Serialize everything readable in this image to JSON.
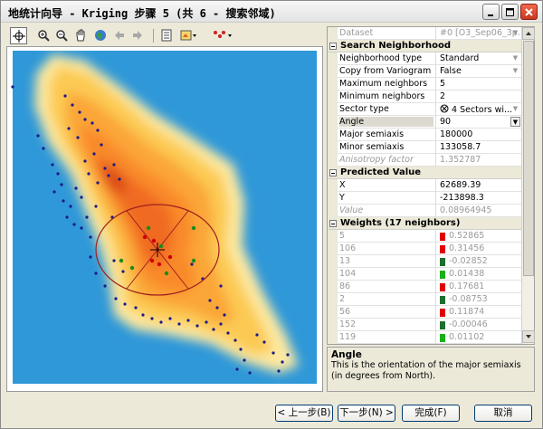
{
  "window": {
    "title": "地统计向导 - Kriging 步骤 5 (共 6 - 搜索邻域)",
    "controls": [
      "minimize-icon",
      "maximize-icon",
      "close-icon"
    ]
  },
  "toolbar": {
    "tools": [
      "pan-target-icon",
      "zoom-in-icon",
      "zoom-out-icon",
      "hand-icon",
      "globe-icon",
      "back-arrow-icon",
      "forward-arrow-icon",
      "layers-icon",
      "map-view-icon",
      "points-icon"
    ]
  },
  "properties": {
    "dataset": {
      "label": "Dataset",
      "value": "#0 [O3_Sep06_3p..."
    },
    "search_neighborhood": {
      "header": "Search Neighborhood",
      "rows": [
        {
          "label": "Neighborhood type",
          "value": "Standard"
        },
        {
          "label": "Copy from Variogram",
          "value": "False"
        },
        {
          "label": "Maximum neighbors",
          "value": "5"
        },
        {
          "label": "Minimum neighbors",
          "value": "2"
        },
        {
          "label": "Sector type",
          "value": "4 Sectors wi..."
        },
        {
          "label": "Angle",
          "value": "90"
        },
        {
          "label": "Major semiaxis",
          "value": "180000"
        },
        {
          "label": "Minor semiaxis",
          "value": "133058.7"
        },
        {
          "label": "Anisotropy factor",
          "value": "1.352787"
        }
      ]
    },
    "predicted_value": {
      "header": "Predicted Value",
      "rows": [
        {
          "label": "X",
          "value": "62689.39"
        },
        {
          "label": "Y",
          "value": "-213898.3"
        },
        {
          "label": "Value",
          "value": "0.08964945"
        }
      ]
    },
    "weights": {
      "header": "Weights (17 neighbors)",
      "rows": [
        {
          "label": "5",
          "value": "0.52865",
          "color": "#e00000"
        },
        {
          "label": "106",
          "value": "0.31456",
          "color": "#e00000"
        },
        {
          "label": "13",
          "value": "-0.02852",
          "color": "#1e6e2e"
        },
        {
          "label": "104",
          "value": "0.01438",
          "color": "#18b018"
        },
        {
          "label": "86",
          "value": "0.17681",
          "color": "#e00000"
        },
        {
          "label": "2",
          "value": "-0.08753",
          "color": "#1e6e2e"
        },
        {
          "label": "56",
          "value": "0.11874",
          "color": "#e00000"
        },
        {
          "label": "152",
          "value": "-0.00046",
          "color": "#1e6e2e"
        },
        {
          "label": "119",
          "value": "0.01102",
          "color": "#18b018"
        }
      ]
    }
  },
  "description": {
    "title": "Angle",
    "text": "This is the orientation of the major semiaxis (in degrees from North)."
  },
  "buttons": {
    "back": "< 上一步(B)",
    "next": "下一步(N) >",
    "finish": "完成(F)",
    "cancel": "取消"
  }
}
